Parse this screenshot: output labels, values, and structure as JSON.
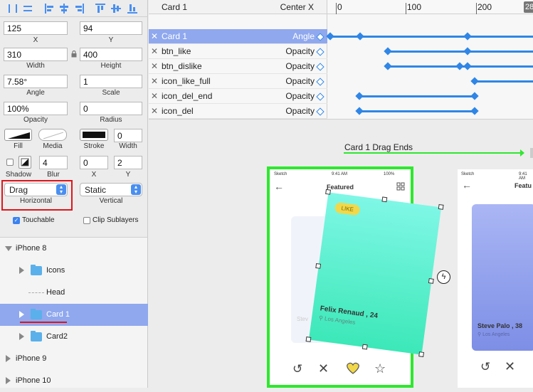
{
  "toolbar": {
    "icons": [
      "align-left-edge-icon",
      "distribute-horizontal-icon",
      "align-left-icon",
      "align-center-icon",
      "align-right-icon",
      "align-top-icon",
      "align-middle-icon",
      "align-bottom-icon"
    ]
  },
  "inspector": {
    "x": {
      "value": "125",
      "label": "X"
    },
    "y": {
      "value": "94",
      "label": "Y"
    },
    "width": {
      "value": "310",
      "label": "Width"
    },
    "height": {
      "value": "400",
      "label": "Height"
    },
    "angle": {
      "value": "7.58°",
      "label": "Angle"
    },
    "scale": {
      "value": "1",
      "label": "Scale"
    },
    "opacity": {
      "value": "100%",
      "label": "Opacity"
    },
    "radius": {
      "value": "0",
      "label": "Radius"
    },
    "fill_label": "Fill",
    "media_label": "Media",
    "stroke_label": "Stroke",
    "stroke_width": {
      "value": "0",
      "label": "Width"
    },
    "shadow_label": "Shadow",
    "blur": {
      "value": "4",
      "label": "Blur"
    },
    "shadow_x": {
      "value": "0",
      "label": "X"
    },
    "shadow_y": {
      "value": "2",
      "label": "Y"
    },
    "horizontal": {
      "value": "Drag",
      "label": "Horizontal"
    },
    "vertical": {
      "value": "Static",
      "label": "Vertical"
    },
    "touchable": {
      "label": "Touchable",
      "checked": true
    },
    "clip": {
      "label": "Clip Sublayers",
      "checked": false
    }
  },
  "layers": {
    "items": [
      {
        "label": "iPhone 8",
        "indent": 0,
        "expanded": true,
        "folder": false
      },
      {
        "label": "Icons",
        "indent": 1,
        "expanded": false,
        "folder": true
      },
      {
        "label": "Head",
        "indent": 1,
        "expanded": false,
        "folder": false
      },
      {
        "label": "Card 1",
        "indent": 1,
        "expanded": false,
        "folder": true,
        "selected": true
      },
      {
        "label": "Card2",
        "indent": 1,
        "expanded": false,
        "folder": true
      },
      {
        "label": "iPhone 9",
        "indent": 0,
        "expanded": false,
        "folder": false
      },
      {
        "label": "iPhone 10",
        "indent": 0,
        "expanded": false,
        "folder": false
      }
    ]
  },
  "timeline": {
    "header": {
      "layer": "Card 1",
      "property": "Center X"
    },
    "ruler": [
      "0",
      "100",
      "200",
      "28"
    ],
    "rows": [
      {
        "layer": "Card 1",
        "property": "Angle",
        "selected": true
      },
      {
        "layer": "btn_like",
        "property": "Opacity"
      },
      {
        "layer": "btn_dislike",
        "property": "Opacity"
      },
      {
        "layer": "icon_like_full",
        "property": "Opacity"
      },
      {
        "layer": "icon_del_end",
        "property": "Opacity"
      },
      {
        "layer": "icon_del",
        "property": "Opacity"
      }
    ]
  },
  "canvas": {
    "drag_label": "Card 1 Drag Ends",
    "phone1": {
      "carrier": "Sketch",
      "time": "9:41 AM",
      "battery": "100%",
      "title": "Featured",
      "like_badge": "LIKE",
      "card_name": "Felix Renaud , 24",
      "card_location": "Los Angeles",
      "ghost_name": "Stev"
    },
    "phone2": {
      "carrier": "Sketch",
      "time": "9:41 AM",
      "title": "Featu",
      "card_name": "Steve Palo , 38",
      "card_location": "Los Angeles"
    }
  },
  "colors": {
    "accent": "#2f86e6",
    "selection": "#8fa8ee",
    "green": "#2ee82e",
    "red": "#e0141b",
    "card_top": "#7ff7e6",
    "card_bottom": "#3ce8b8",
    "heart": "#f1d84a"
  }
}
